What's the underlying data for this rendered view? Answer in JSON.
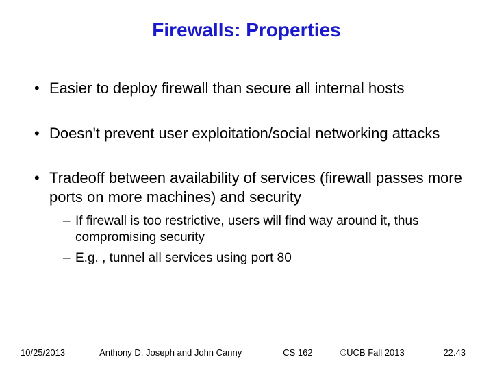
{
  "title": "Firewalls: Properties",
  "bullets": {
    "b0": "Easier to deploy firewall than secure all internal hosts",
    "b1": "Doesn't prevent user exploitation/social networking attacks",
    "b2": "Tradeoff between availability of services (firewall passes more ports on more machines) and security",
    "b2sub": {
      "s0": "If firewall is too restrictive, users will find way around it, thus compromising security",
      "s1": "E.g. , tunnel all services using port 80"
    }
  },
  "footer": {
    "date": "10/25/2013",
    "authors": "Anthony D. Joseph and John Canny",
    "course": "CS 162",
    "copyright": "©UCB Fall 2013",
    "slide_number": "22.43"
  }
}
